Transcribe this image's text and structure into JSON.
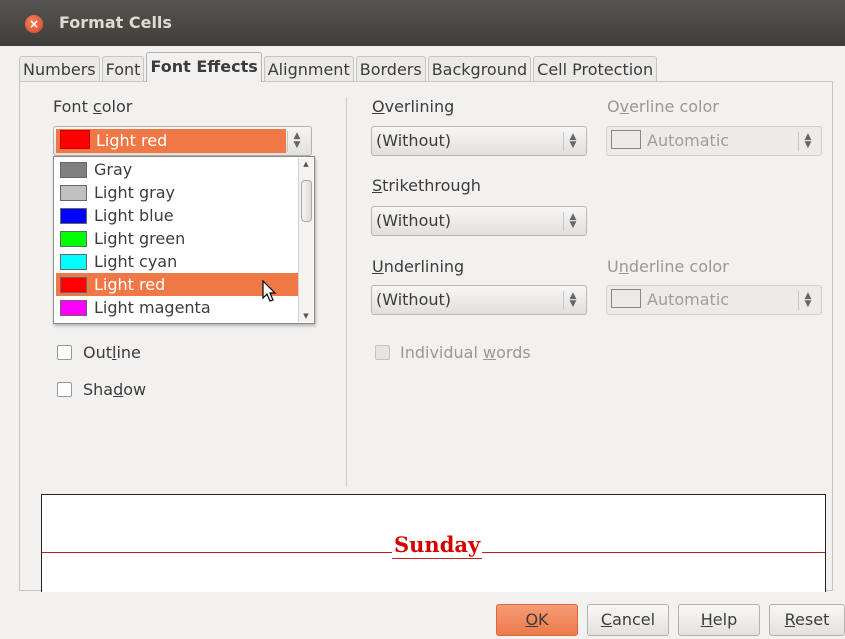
{
  "window": {
    "title": "Format Cells",
    "close_glyph": "×"
  },
  "tabs": [
    {
      "label": "Numbers"
    },
    {
      "label": "Font"
    },
    {
      "label": "Font Effects",
      "active": true
    },
    {
      "label": "Alignment"
    },
    {
      "label": "Borders"
    },
    {
      "label": "Background"
    },
    {
      "label": "Cell Protection"
    }
  ],
  "font_color": {
    "label_pre": "Font ",
    "label_mnemonic": "c",
    "label_post": "olor",
    "selected": "Light red",
    "selected_color": "#ff0000",
    "options": [
      {
        "label": "Gray",
        "color": "#808080"
      },
      {
        "label": "Light gray",
        "color": "#c0c0c0"
      },
      {
        "label": "Light blue",
        "color": "#0000ff"
      },
      {
        "label": "Light green",
        "color": "#00ff00"
      },
      {
        "label": "Light cyan",
        "color": "#00ffff"
      },
      {
        "label": "Light red",
        "color": "#ff0000",
        "selected": true
      },
      {
        "label": "Light magenta",
        "color": "#ff00ff"
      }
    ]
  },
  "outline": {
    "label_pre": "Out",
    "label_mnemonic": "l",
    "label_post": "ine",
    "checked": false
  },
  "shadow": {
    "label_pre": "Sha",
    "label_mnemonic": "d",
    "label_post": "ow",
    "checked": false
  },
  "overlining": {
    "label_mnemonic": "O",
    "label_post": "verlining",
    "value": "(Without)"
  },
  "overline_color": {
    "label_pre": "O",
    "label_mnemonic": "v",
    "label_post": "erline color",
    "value": "Automatic"
  },
  "strikethrough": {
    "label_mnemonic": "S",
    "label_post": "trikethrough",
    "value": "(Without)"
  },
  "underlining": {
    "label_mnemonic": "U",
    "label_post": "nderlining",
    "value": "(Without)"
  },
  "underline_color": {
    "label_pre": "U",
    "label_mnemonic": "n",
    "label_post": "derline color",
    "value": "Automatic"
  },
  "individual_words": {
    "label_pre": "Individual ",
    "label_mnemonic": "w",
    "label_post": "ords",
    "checked": false
  },
  "preview": {
    "text": "Sunday"
  },
  "buttons": {
    "ok": {
      "mnemonic": "O",
      "rest": "K"
    },
    "cancel": {
      "mnemonic": "C",
      "rest": "ancel"
    },
    "help": {
      "mnemonic": "H",
      "rest": "elp"
    },
    "reset": {
      "mnemonic": "R",
      "rest": "eset"
    }
  }
}
